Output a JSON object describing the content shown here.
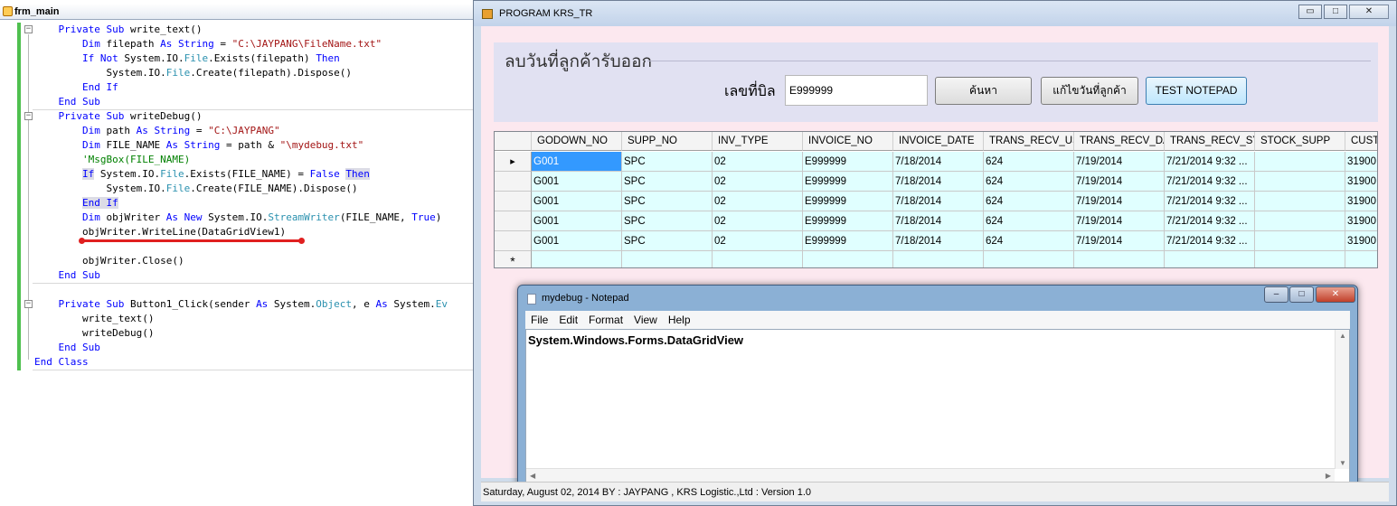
{
  "editor": {
    "tab_title": "frm_main",
    "lines": [
      {
        "indent": "    ",
        "parts": [
          {
            "t": "Private",
            "c": "kw"
          },
          {
            "t": " "
          },
          {
            "t": "Sub",
            "c": "kw"
          },
          {
            "t": " write_text()"
          }
        ]
      },
      {
        "indent": "        ",
        "parts": [
          {
            "t": "Dim",
            "c": "kw"
          },
          {
            "t": " filepath "
          },
          {
            "t": "As",
            "c": "kw"
          },
          {
            "t": " "
          },
          {
            "t": "String",
            "c": "kw"
          },
          {
            "t": " = "
          },
          {
            "t": "\"C:\\JAYPANG\\FileName.txt\"",
            "c": "st"
          }
        ]
      },
      {
        "indent": "        ",
        "parts": [
          {
            "t": "If",
            "c": "kw"
          },
          {
            "t": " "
          },
          {
            "t": "Not",
            "c": "kw"
          },
          {
            "t": " System.IO."
          },
          {
            "t": "File",
            "c": "ty"
          },
          {
            "t": ".Exists(filepath) "
          },
          {
            "t": "Then",
            "c": "kw"
          }
        ]
      },
      {
        "indent": "            ",
        "parts": [
          {
            "t": "System.IO."
          },
          {
            "t": "File",
            "c": "ty"
          },
          {
            "t": ".Create(filepath).Dispose()"
          }
        ]
      },
      {
        "indent": "        ",
        "parts": [
          {
            "t": "End If",
            "c": "kw"
          }
        ]
      },
      {
        "indent": "    ",
        "parts": [
          {
            "t": "End Sub",
            "c": "kw"
          }
        ]
      },
      {
        "indent": "    ",
        "parts": [
          {
            "t": "Private",
            "c": "kw"
          },
          {
            "t": " "
          },
          {
            "t": "Sub",
            "c": "kw"
          },
          {
            "t": " writeDebug()"
          }
        ]
      },
      {
        "indent": "        ",
        "parts": [
          {
            "t": "Dim",
            "c": "kw"
          },
          {
            "t": " path "
          },
          {
            "t": "As",
            "c": "kw"
          },
          {
            "t": " "
          },
          {
            "t": "String",
            "c": "kw"
          },
          {
            "t": " = "
          },
          {
            "t": "\"C:\\JAYPANG\"",
            "c": "st"
          }
        ]
      },
      {
        "indent": "        ",
        "parts": [
          {
            "t": "Dim",
            "c": "kw"
          },
          {
            "t": " FILE_NAME "
          },
          {
            "t": "As",
            "c": "kw"
          },
          {
            "t": " "
          },
          {
            "t": "String",
            "c": "kw"
          },
          {
            "t": " = path & "
          },
          {
            "t": "\"\\mydebug.txt\"",
            "c": "st"
          }
        ]
      },
      {
        "indent": "        ",
        "parts": [
          {
            "t": "'MsgBox(FILE_NAME)",
            "c": "cm"
          }
        ]
      },
      {
        "indent": "        ",
        "parts": [
          {
            "t": "If",
            "c": "kw hl"
          },
          {
            "t": " System.IO."
          },
          {
            "t": "File",
            "c": "ty"
          },
          {
            "t": ".Exists(FILE_NAME) = "
          },
          {
            "t": "False",
            "c": "kw"
          },
          {
            "t": " "
          },
          {
            "t": "Then",
            "c": "kw hl"
          }
        ]
      },
      {
        "indent": "            ",
        "parts": [
          {
            "t": "System.IO."
          },
          {
            "t": "File",
            "c": "ty"
          },
          {
            "t": ".Create(FILE_NAME).Dispose()"
          }
        ]
      },
      {
        "indent": "        ",
        "parts": [
          {
            "t": "End If",
            "c": "kw hl"
          }
        ]
      },
      {
        "indent": "        ",
        "parts": [
          {
            "t": "Dim",
            "c": "kw"
          },
          {
            "t": " objWriter "
          },
          {
            "t": "As",
            "c": "kw"
          },
          {
            "t": " "
          },
          {
            "t": "New",
            "c": "kw"
          },
          {
            "t": " System.IO."
          },
          {
            "t": "StreamWriter",
            "c": "ty"
          },
          {
            "t": "(FILE_NAME, "
          },
          {
            "t": "True",
            "c": "kw"
          },
          {
            "t": ")"
          }
        ]
      },
      {
        "indent": "        ",
        "parts": [
          {
            "t": "objWriter.WriteLine(DataGridView1)"
          }
        ]
      },
      {
        "indent": "",
        "parts": []
      },
      {
        "indent": "        ",
        "parts": [
          {
            "t": "objWriter.Close()"
          }
        ]
      },
      {
        "indent": "    ",
        "parts": [
          {
            "t": "End Sub",
            "c": "kw"
          }
        ]
      },
      {
        "indent": "",
        "parts": []
      },
      {
        "indent": "    ",
        "parts": [
          {
            "t": "Private",
            "c": "kw"
          },
          {
            "t": " "
          },
          {
            "t": "Sub",
            "c": "kw"
          },
          {
            "t": " Button1_Click(sender "
          },
          {
            "t": "As",
            "c": "kw"
          },
          {
            "t": " System."
          },
          {
            "t": "Object",
            "c": "ty"
          },
          {
            "t": ", e "
          },
          {
            "t": "As",
            "c": "kw"
          },
          {
            "t": " System."
          },
          {
            "t": "Ev",
            "c": "ty"
          }
        ]
      },
      {
        "indent": "        ",
        "parts": [
          {
            "t": "write_text()"
          }
        ]
      },
      {
        "indent": "        ",
        "parts": [
          {
            "t": "writeDebug()"
          }
        ]
      },
      {
        "indent": "    ",
        "parts": [
          {
            "t": "End Sub",
            "c": "kw"
          }
        ]
      },
      {
        "indent": "",
        "parts": [
          {
            "t": "End Class",
            "c": "kw"
          }
        ]
      }
    ]
  },
  "app": {
    "title": "PROGRAM KRS_TR",
    "min_glyph": "▭",
    "max_glyph": "□",
    "close_glyph": "✕",
    "panel_title": "ลบวันที่ลูกค้ารับออก",
    "bill_label": "เลขที่บิล",
    "bill_value": "E999999",
    "btn_search": "ค้นหา",
    "btn_edit": "แก้ไขวันที่ลูกค้า",
    "btn_test": "TEST NOTEPAD",
    "status": "Saturday, August 02, 2014  BY : JAYPANG , KRS Logistic.,Ltd :  Version 1.0"
  },
  "grid": {
    "columns": [
      "GODOWN_NO",
      "SUPP_NO",
      "INV_TYPE",
      "INVOICE_NO",
      "INVOICE_DATE",
      "TRANS_RECV_US",
      "TRANS_RECV_DA",
      "TRANS_RECV_SY",
      "STOCK_SUPP",
      "CUST"
    ],
    "rows": [
      [
        "G001",
        "SPC",
        "02",
        "E999999",
        "7/18/2014",
        "624",
        "7/19/2014",
        "7/21/2014 9:32 ...",
        "",
        "31900"
      ],
      [
        "G001",
        "SPC",
        "02",
        "E999999",
        "7/18/2014",
        "624",
        "7/19/2014",
        "7/21/2014 9:32 ...",
        "",
        "31900"
      ],
      [
        "G001",
        "SPC",
        "02",
        "E999999",
        "7/18/2014",
        "624",
        "7/19/2014",
        "7/21/2014 9:32 ...",
        "",
        "31900"
      ],
      [
        "G001",
        "SPC",
        "02",
        "E999999",
        "7/18/2014",
        "624",
        "7/19/2014",
        "7/21/2014 9:32 ...",
        "",
        "31900"
      ],
      [
        "G001",
        "SPC",
        "02",
        "E999999",
        "7/18/2014",
        "624",
        "7/19/2014",
        "7/21/2014 9:32 ...",
        "",
        "31900"
      ]
    ],
    "current_row_marker": "▸",
    "new_row_marker": "*"
  },
  "notepad": {
    "title": "mydebug - Notepad",
    "menu": [
      "File",
      "Edit",
      "Format",
      "View",
      "Help"
    ],
    "content": "System.Windows.Forms.DataGridView",
    "close_glyph": "✕",
    "min_glyph": "–",
    "max_glyph": "□"
  }
}
